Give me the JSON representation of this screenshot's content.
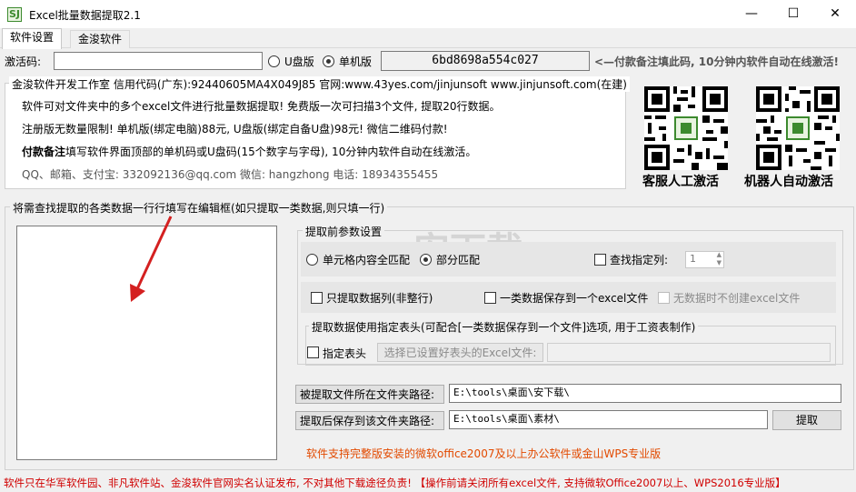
{
  "window": {
    "app_icon": "SJ",
    "title": "Excel批量数据提取2.1",
    "minimize_glyph": "—",
    "maximize_glyph": "☐",
    "close_glyph": "✕"
  },
  "tabs": [
    {
      "label": "软件设置"
    },
    {
      "label": "金浚软件"
    }
  ],
  "activation": {
    "label": "激活码:",
    "value": "",
    "options": [
      {
        "label": "U盘版",
        "checked": false
      },
      {
        "label": "单机版",
        "checked": true
      }
    ],
    "machine_code": "6bd8698a554c027",
    "note": "<—付款备注填此码, 10分钟内软件自动在线激活!"
  },
  "info": {
    "group_title": "金浚软件开发工作室 信用代码(广东):92440605MA4X049J85 官网:www.43yes.com/jinjunsoft  www.jinjunsoft.com(在建)",
    "line1": "软件可对文件夹中的多个excel文件进行批量数据提取! 免费版一次可扫描3个文件, 提取20行数据。",
    "line2": "注册版无数量限制! 单机版(绑定电脑)88元, U盘版(绑定自备U盘)98元! 微信二维码付款!",
    "line3_bold": "付款备注",
    "line3_rest": "填写软件界面顶部的单机码或U盘码(15个数字与字母), 10分钟内软件自动在线激活。",
    "contact": "QQ、邮箱、支付宝: 332092136@qq.com   微信: hangzhong   电话: 18934355455"
  },
  "qr": [
    {
      "caption": "客服人工激活"
    },
    {
      "caption": "机器人自动激活"
    }
  ],
  "edit_group": {
    "title": "将需查找提取的各类数据一行行填写在编辑框(如只提取一类数据,则只填一行)",
    "content": ""
  },
  "params": {
    "title": "提取前参数设置",
    "match_cell": "单元格内容全匹配",
    "match_partial": "部分匹配",
    "match_selected": "partial",
    "find_column": "查找指定列:",
    "find_column_checked": false,
    "column_value": "1",
    "only_column": "只提取数据列(非整行)",
    "one_type_one_file": "一类数据保存到一个excel文件",
    "no_data_no_file": "无数据时不创建excel文件",
    "header_group_title": "提取数据使用指定表头(可配合[一类数据保存到一个文件]选项, 用于工资表制作)",
    "use_header": "指定表头",
    "choose_header_btn": "选择已设置好表头的Excel文件:",
    "header_path": ""
  },
  "paths": {
    "source_label": "被提取文件所在文件夹路径:",
    "source_value": "E:\\tools\\桌面\\安下载\\",
    "target_label": "提取后保存到该文件夹路径:",
    "target_value": "E:\\tools\\桌面\\素材\\",
    "extract_btn": "提取"
  },
  "support_note": "软件支持完整版安装的微软office2007及以上办公软件或金山WPS专业版",
  "footer": "软件只在华军软件园、非凡软件站、金浚软件官网实名认证发布, 不对其他下载途径负责! 【操作前请关闭所有excel文件, 支持微软Office2007以上、WPS2016专业版】",
  "watermark": "安下载",
  "colors": {
    "accent_red": "#d00000",
    "accent_orange": "#e24a00",
    "arrow": "#d42020"
  }
}
